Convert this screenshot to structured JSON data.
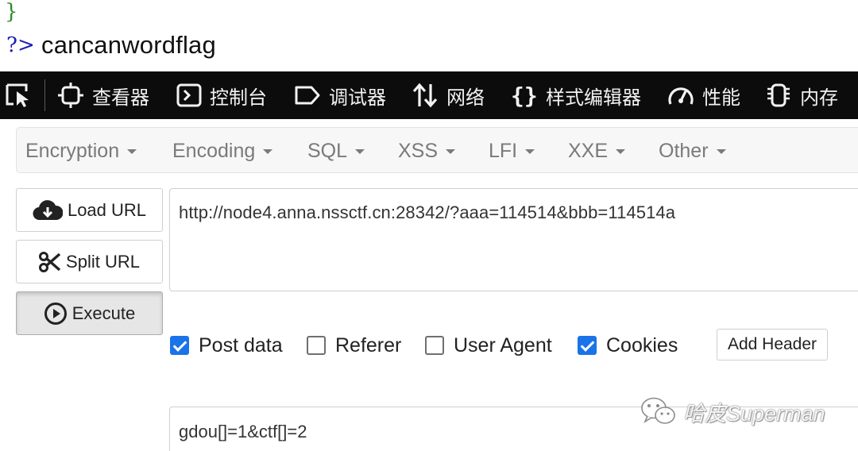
{
  "php_output": {
    "closing_brace": "}",
    "closing_tag": "?>",
    "echo_text": "cancanwordflag"
  },
  "devtools": {
    "tabs": [
      {
        "label": "查看器",
        "icon": "inspector-icon"
      },
      {
        "label": "控制台",
        "icon": "console-icon"
      },
      {
        "label": "调试器",
        "icon": "debugger-icon"
      },
      {
        "label": "网络",
        "icon": "network-arrows-icon"
      },
      {
        "label": "样式编辑器",
        "icon": "braces-icon"
      },
      {
        "label": "性能",
        "icon": "gauge-icon"
      },
      {
        "label": "内存",
        "icon": "chip-icon"
      }
    ]
  },
  "hackbar": {
    "menus": [
      "Encryption",
      "Encoding",
      "SQL",
      "XSS",
      "LFI",
      "XXE",
      "Other"
    ],
    "buttons": {
      "load_url": "Load URL",
      "split_url": "Split URL",
      "execute": "Execute"
    },
    "url": "http://node4.anna.nssctf.cn:28342/?aaa=114514&bbb=114514a",
    "options": {
      "post_data": {
        "label": "Post data",
        "checked": true
      },
      "referer": {
        "label": "Referer",
        "checked": false
      },
      "user_agent": {
        "label": "User Agent",
        "checked": false
      },
      "cookies": {
        "label": "Cookies",
        "checked": true
      }
    },
    "add_header": "Add Header",
    "post_body": "gdou[]=1&ctf[]=2"
  },
  "watermark": {
    "text": "哈皮Superman"
  },
  "colors": {
    "toolbar_bg": "#0c0c0d",
    "checkbox_on": "#1a73e8",
    "php_brace": "#2e8b2e",
    "php_tag": "#1c1cb4"
  }
}
